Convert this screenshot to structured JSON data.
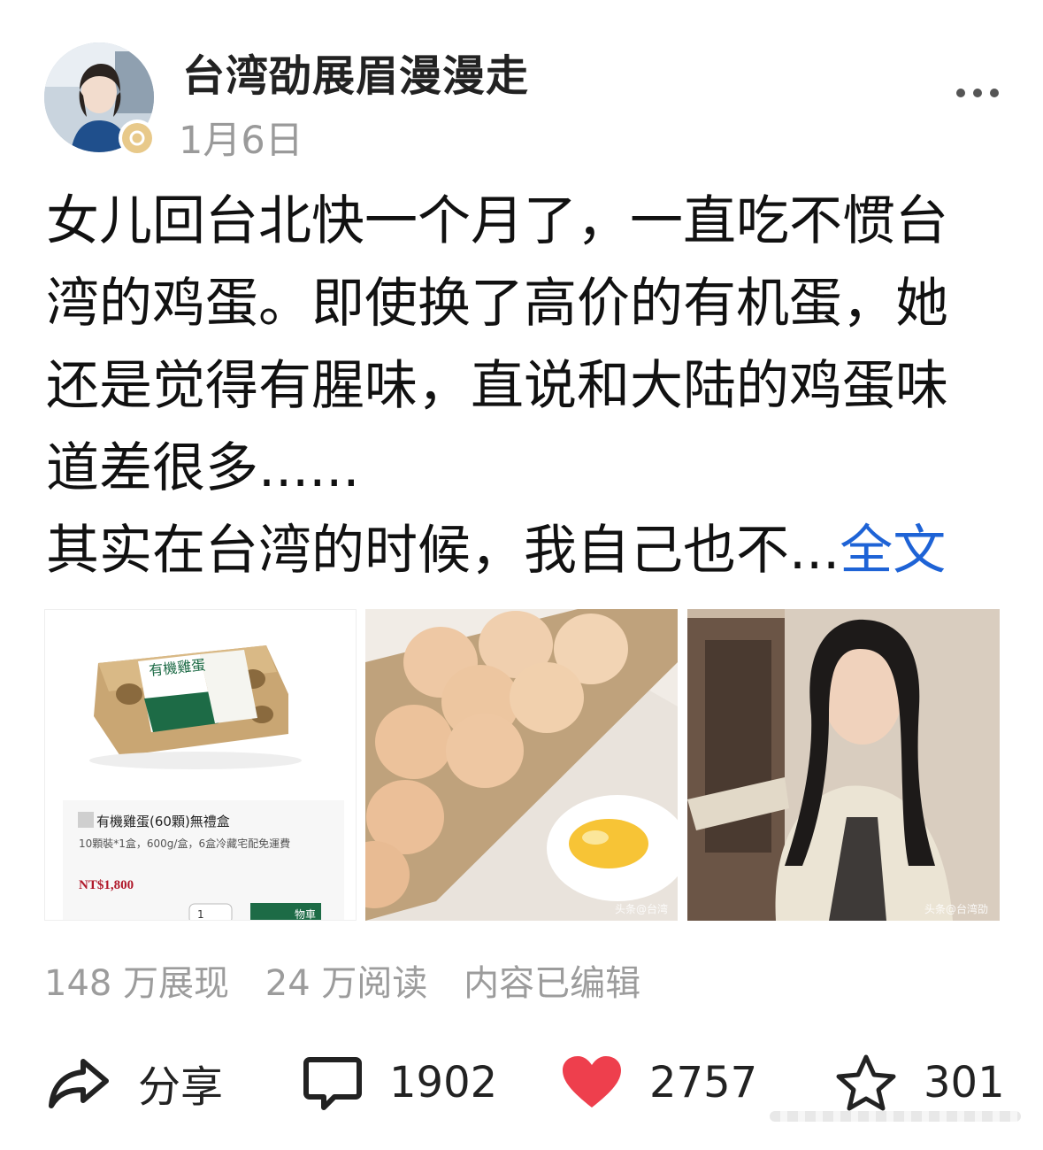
{
  "author": {
    "name": "台湾劭展眉漫漫走",
    "date": "1月6日"
  },
  "post": {
    "lines": [
      "女儿回台北快一个月了，一直吃不惯台",
      "湾的鸡蛋。即使换了高价的有机蛋，她",
      "还是觉得有腥味，直说和大陆的鸡蛋味",
      "道差很多......"
    ],
    "last_line": "其实在台湾的时候，我自己也不...",
    "read_more": "全文"
  },
  "images": {
    "product": {
      "box_label": "有機雞蛋",
      "title": "有機雞蛋(60顆)無禮盒",
      "desc": "10顆裝*1盒，600g/盒，6盒冷藏宅配免運費",
      "price": "NT$1,800",
      "qty": "1",
      "cart_button": "物車"
    },
    "eggs_watermark": "头条@台湾",
    "girl_watermark": "头条@台湾劭"
  },
  "stats": {
    "views": "148 万展现",
    "reads": "24 万阅读",
    "edited": "内容已编辑"
  },
  "actions": {
    "share": "分享",
    "comments": "1902",
    "likes": "2757",
    "favorites": "301"
  },
  "colors": {
    "link": "#1e63d6",
    "like": "#ee3f4d",
    "muted": "#9a9a9a"
  }
}
